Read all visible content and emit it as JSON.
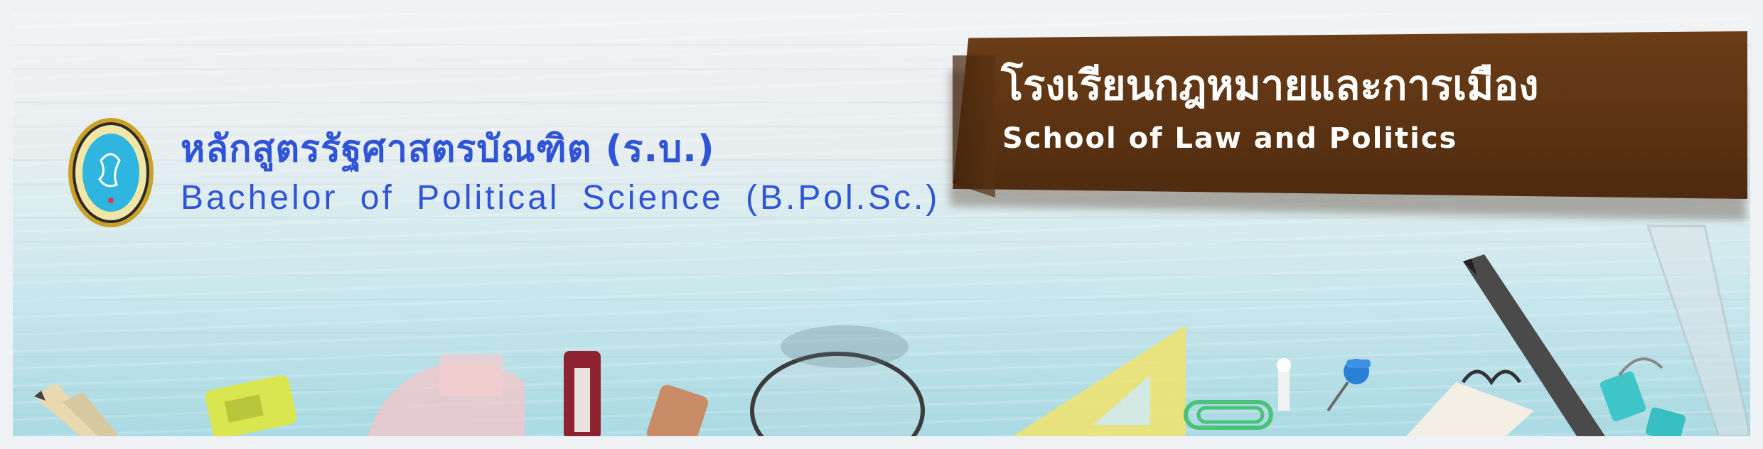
{
  "banner": {
    "subject_th": "หลักสูตรรัฐศาสตรบัณฑิต (ร.บ.)",
    "subject_en": "Bachelor of Political Science (B.Pol.Sc.)",
    "school_th": "โรงเรียนกฎหมายและการเมือง",
    "school_en": "School of Law and Politics",
    "logo": {
      "icon": "university-seal-icon"
    }
  },
  "colors": {
    "subject_text": "#2f55d6",
    "plaque": "#5a3212",
    "plaque_text": "#ffffff",
    "seal_blue": "#2fb6e0",
    "seal_gold": "#c9a227"
  },
  "decorations": [
    "pencil-icon",
    "sharpener-icon",
    "protractor-icon",
    "utility-knife-icon",
    "eraser-icon",
    "magnifying-glass-icon",
    "set-square-icon",
    "paper-clip-icon",
    "push-pin-icon",
    "notebook-icon",
    "pen-icon",
    "binder-clip-icon",
    "ruler-icon"
  ]
}
